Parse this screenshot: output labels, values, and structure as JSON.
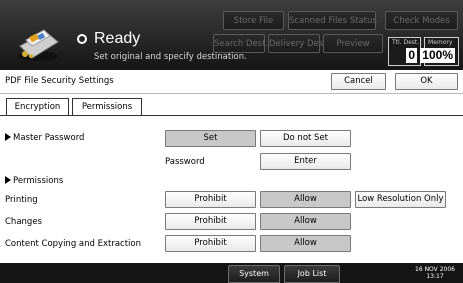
{
  "header": {
    "top_buttons": [
      "Store File",
      "Scanned Files Status",
      "Check Modes"
    ],
    "mode_buttons": [
      "Search Dest.",
      "Delivery Dest.",
      "Preview"
    ],
    "status_title": "Ready",
    "status_message": "Set original and specify destination.",
    "total_dest": {
      "label": "Ttl. Dest.",
      "value": "0"
    },
    "memory": {
      "label": "Memory",
      "value": "100%"
    }
  },
  "panel": {
    "title": "PDF File Security Settings",
    "cancel_label": "Cancel",
    "ok_label": "OK"
  },
  "tabs": [
    {
      "label": "Encryption",
      "active": false
    },
    {
      "label": "Permissions",
      "active": true
    }
  ],
  "master_password": {
    "label": "Master Password",
    "set_label": "Set",
    "set_selected": true,
    "do_not_set_label": "Do not Set",
    "password_label": "Password",
    "enter_label": "Enter"
  },
  "permissions": {
    "heading": "Permissions",
    "rows": [
      {
        "label": "Printing",
        "prohibit": "Prohibit",
        "allow": "Allow",
        "low_res": "Low Resolution Only",
        "selected": "allow"
      },
      {
        "label": "Changes",
        "prohibit": "Prohibit",
        "allow": "Allow",
        "selected": "allow"
      },
      {
        "label": "Content Copying and Extraction",
        "prohibit": "Prohibit",
        "allow": "Allow",
        "selected": "allow"
      }
    ]
  },
  "footer": {
    "system_status_label": "System Status",
    "job_list_label": "Job List",
    "date": "16 NOV  2006",
    "time": "13:17"
  }
}
